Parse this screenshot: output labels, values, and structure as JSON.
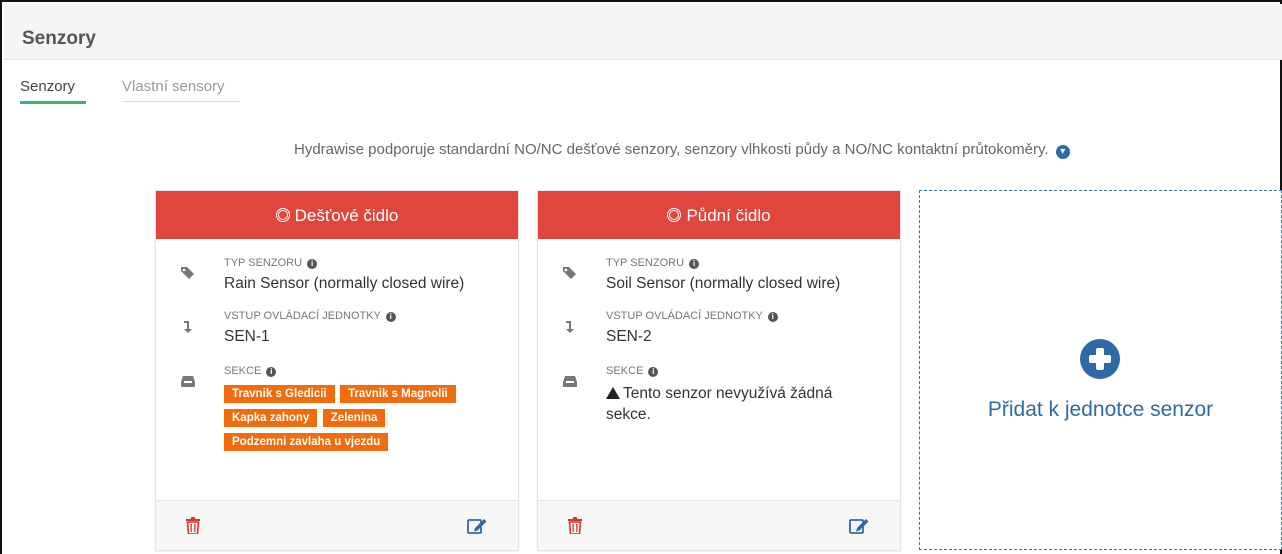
{
  "page": {
    "title": "Senzory"
  },
  "tabs": [
    {
      "label": "Senzory",
      "active": true
    },
    {
      "label": "Vlastní sensory",
      "active": false
    }
  ],
  "info": {
    "text": "Hydrawise podporuje standardní NO/NC dešťové senzory, senzory vlhkosti půdy a NO/NC kontaktní průtokoměry.",
    "icon": "chevron-down-circle-icon"
  },
  "colors": {
    "header_red": "#e0463c",
    "tag_orange": "#f26c0d",
    "accent_blue": "#2f6aa8",
    "active_tab_green": "#3cb371"
  },
  "cards": [
    {
      "title": "Dešťové čidlo",
      "type_label": "TYP SENZORU",
      "type_value": "Rain Sensor (normally closed wire)",
      "input_label": "VSTUP OVLÁDACÍ JEDNOTKY",
      "input_value": "SEN-1",
      "zones_label": "SEKCE",
      "zones": [
        "Travnik s Gledicii",
        "Travnik s Magnolii",
        "Kapka zahony",
        "Zelenina",
        "Podzemni zavlaha u vjezdu"
      ]
    },
    {
      "title": "Půdní čidlo",
      "type_label": "TYP SENZORU",
      "type_value": "Soil Sensor (normally closed wire)",
      "input_label": "VSTUP OVLÁDACÍ JEDNOTKY",
      "input_value": "SEN-2",
      "zones_label": "SEKCE",
      "zones_warning": "Tento senzor nevyužívá žádná sekce."
    }
  ],
  "add_card": {
    "label": "Přidat k jednotce senzor"
  }
}
